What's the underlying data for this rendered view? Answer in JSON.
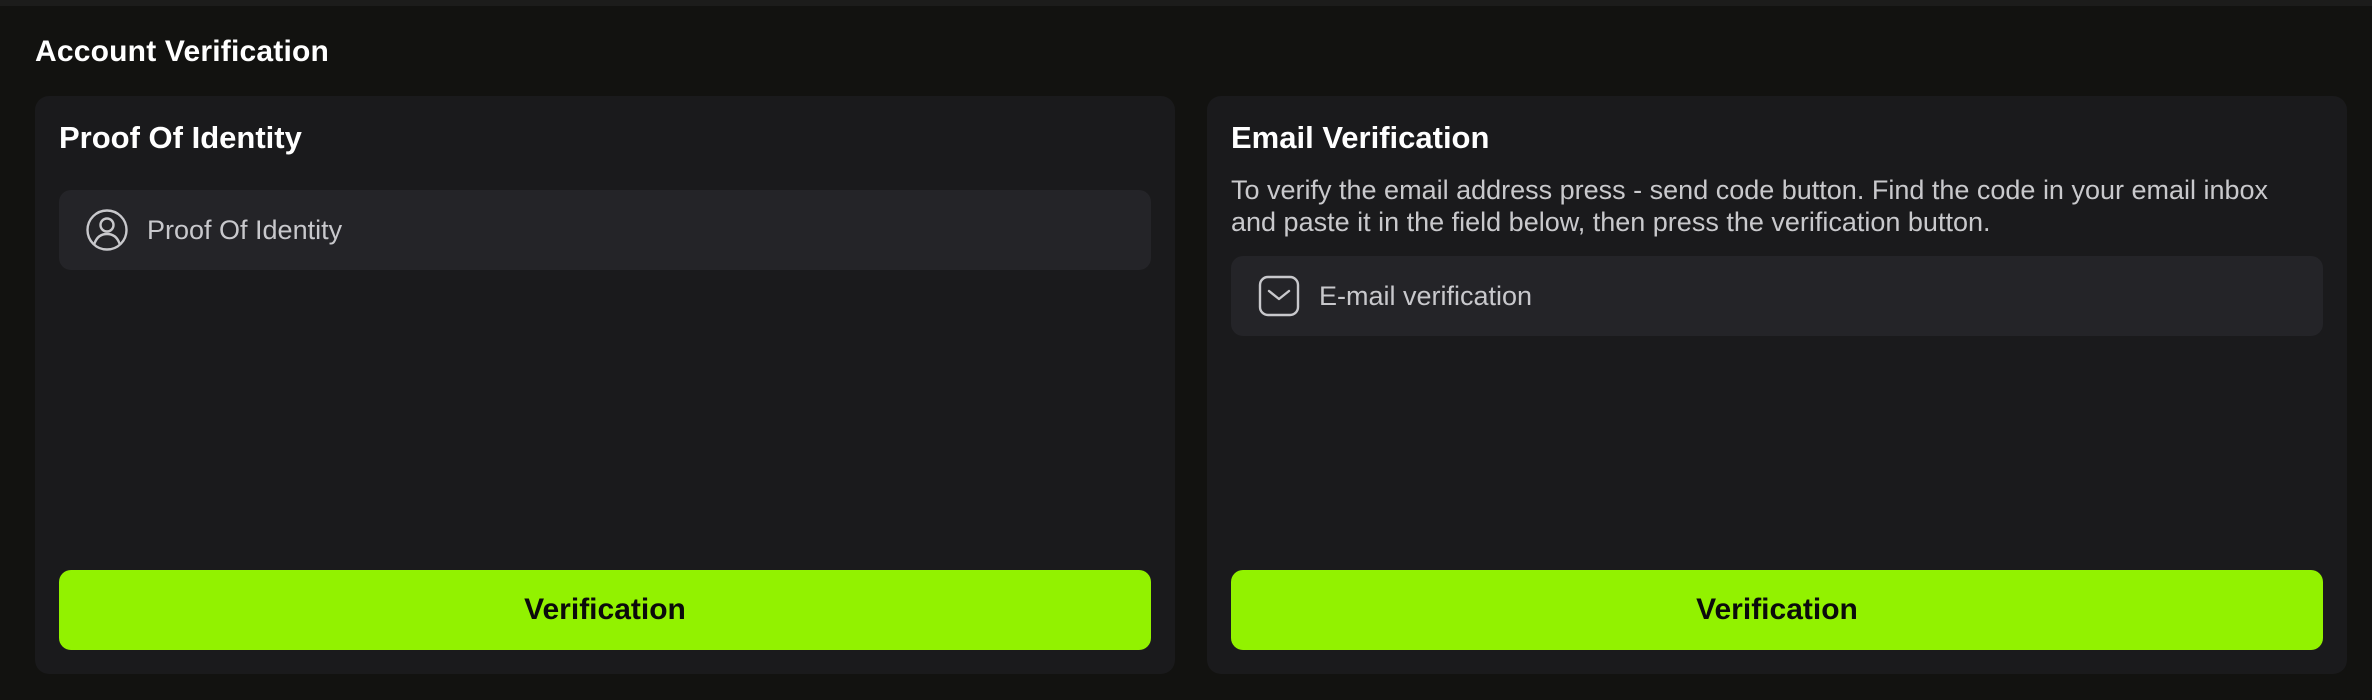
{
  "section": {
    "title": "Account Verification"
  },
  "identity_card": {
    "title": "Proof Of Identity",
    "field_label": "Proof Of Identity",
    "field_icon": "user-circle-icon",
    "button_label": "Verification"
  },
  "email_card": {
    "title": "Email Verification",
    "description": "To verify the email address press - send code button. Find the code in your email inbox and paste it in the field below, then press the verification button.",
    "field_label": "E-mail verification",
    "field_icon": "mail-icon",
    "button_label": "Verification"
  },
  "colors": {
    "background": "#121210",
    "card": "#1a1a1c",
    "field": "#242428",
    "accent": "#92f200"
  }
}
